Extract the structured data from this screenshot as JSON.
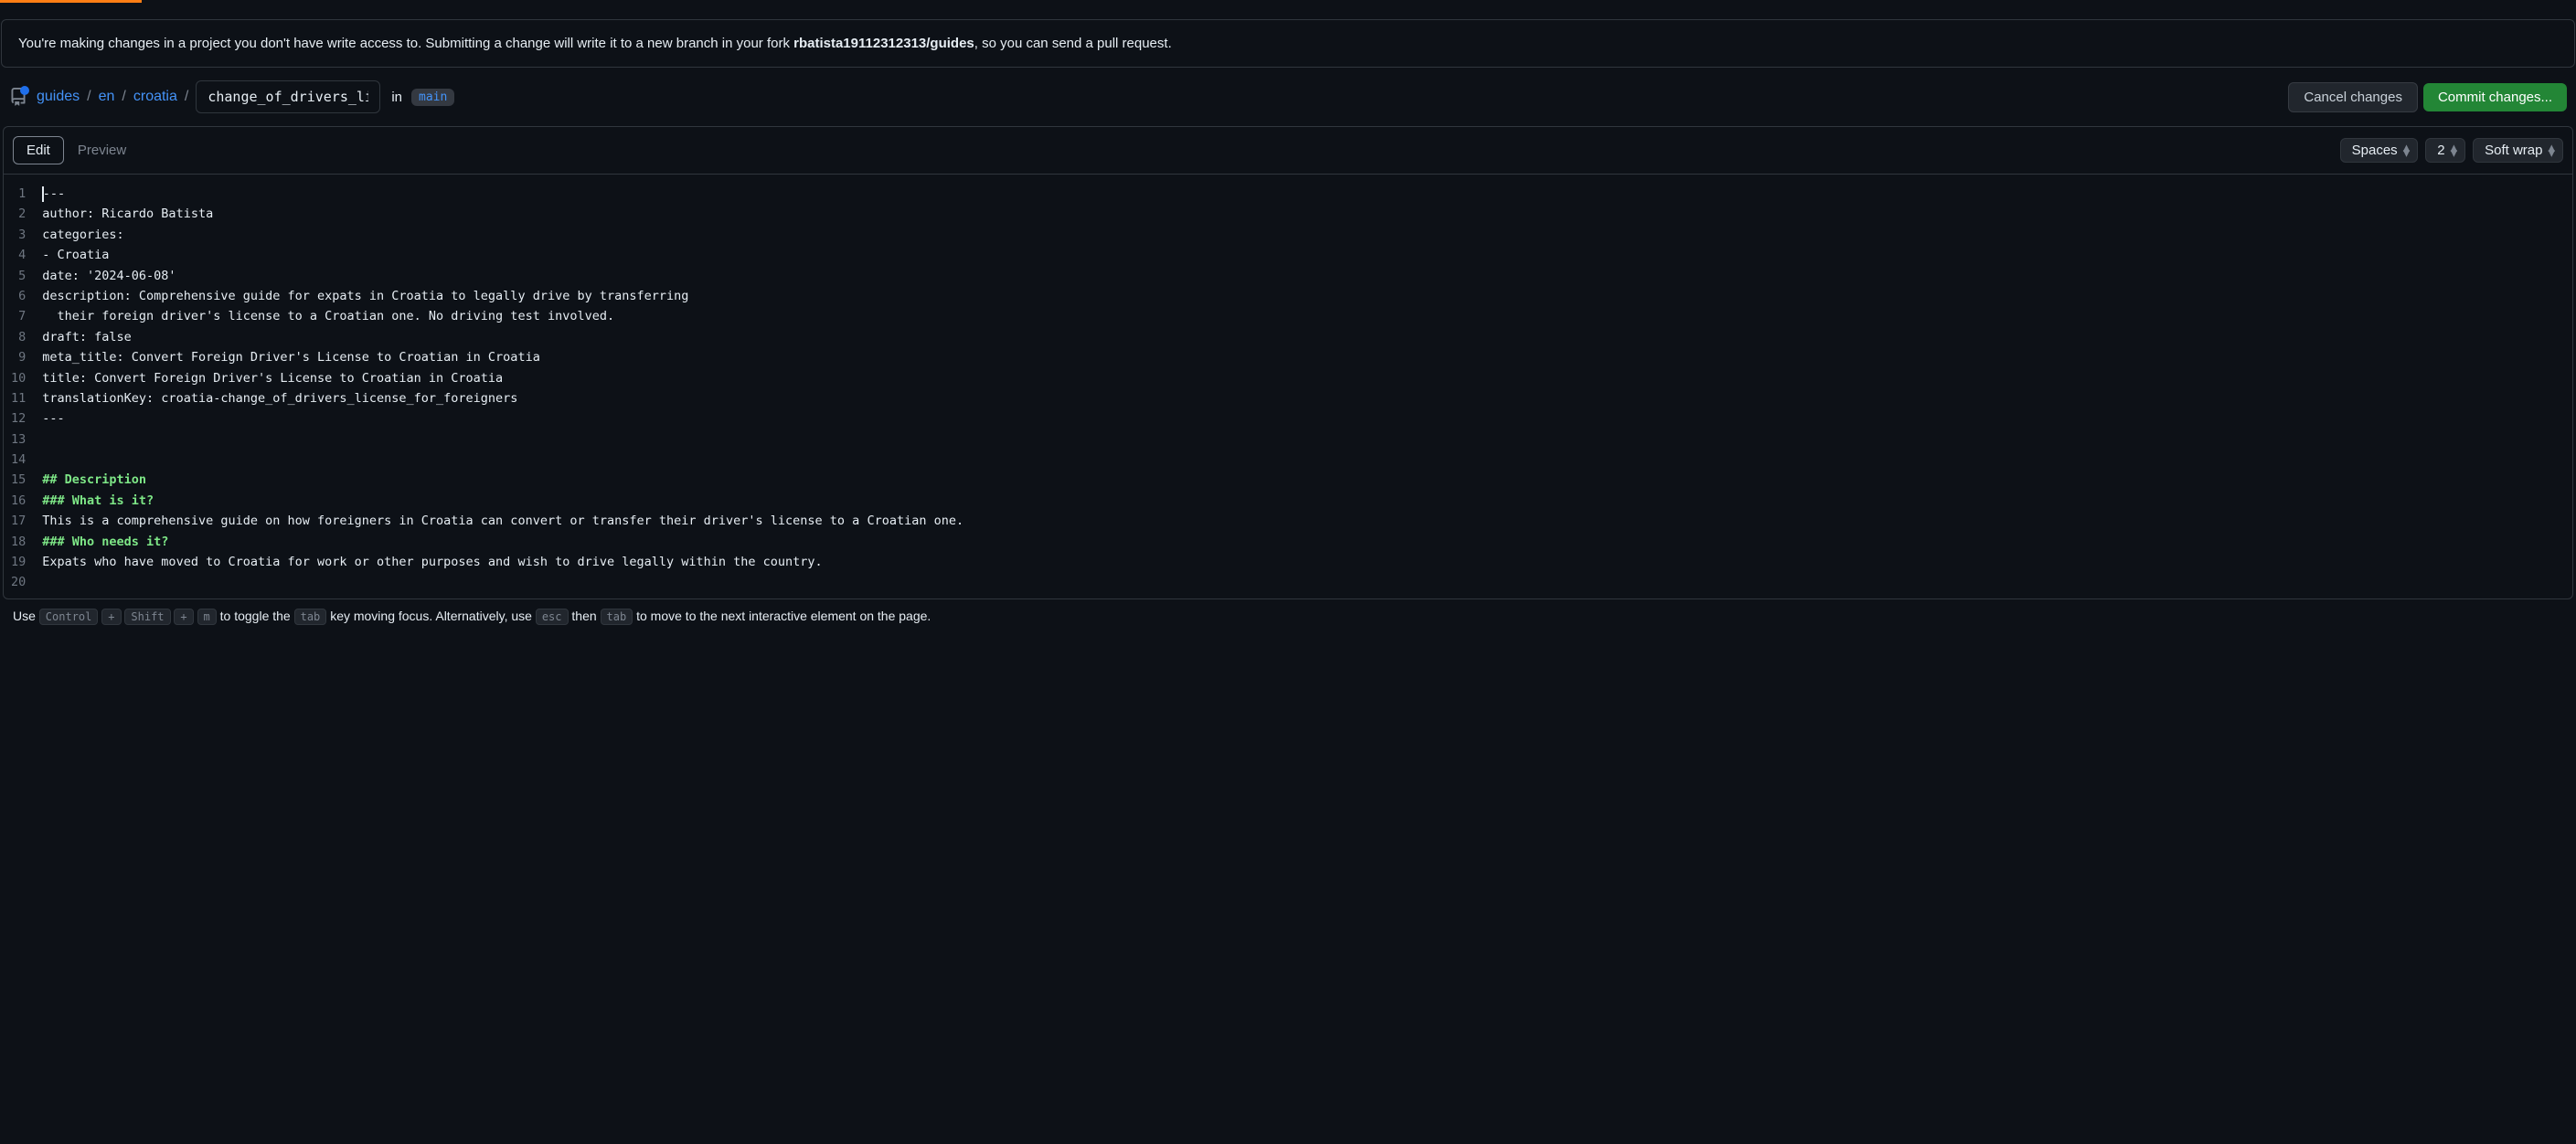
{
  "progress": {
    "percent": 5.5
  },
  "notice": {
    "prefix": "You're making changes in a project you don't have write access to. Submitting a change will write it to a new branch in your fork ",
    "fork": "rbatista19112312313/guides",
    "suffix": ", so you can send a pull request."
  },
  "breadcrumb": {
    "repo": "guides",
    "seg1": "en",
    "seg2": "croatia",
    "filename": "change_of_drivers_licen",
    "in_label": "in",
    "branch": "main"
  },
  "actions": {
    "cancel": "Cancel changes",
    "commit": "Commit changes..."
  },
  "tabs": {
    "edit": "Edit",
    "preview": "Preview"
  },
  "toolbar": {
    "indent_mode": "Spaces",
    "indent_size": "2",
    "wrap_mode": "Soft wrap"
  },
  "code": {
    "lines": [
      "---",
      "author: Ricardo Batista",
      "categories:",
      "- Croatia",
      "date: '2024-06-08'",
      "description: Comprehensive guide for expats in Croatia to legally drive by transferring",
      "  their foreign driver's license to a Croatian one. No driving test involved.",
      "draft: false",
      "meta_title: Convert Foreign Driver's License to Croatian in Croatia",
      "title: Convert Foreign Driver's License to Croatian in Croatia",
      "translationKey: croatia-change_of_drivers_license_for_foreigners",
      "---",
      "",
      "",
      "## Description",
      "### What is it?",
      "This is a comprehensive guide on how foreigners in Croatia can convert or transfer their driver's license to a Croatian one.",
      "### Who needs it?",
      "Expats who have moved to Croatia for work or other purposes and wish to drive legally within the country.",
      ""
    ]
  },
  "hint": {
    "t1": "Use ",
    "k1": "Control",
    "plus": "+",
    "k2": "Shift",
    "k3": "m",
    "t2": " to toggle the ",
    "k4": "tab",
    "t3": " key moving focus. Alternatively, use ",
    "k5": "esc",
    "t4": " then ",
    "k6": "tab",
    "t5": " to move to the next interactive element on the page."
  }
}
